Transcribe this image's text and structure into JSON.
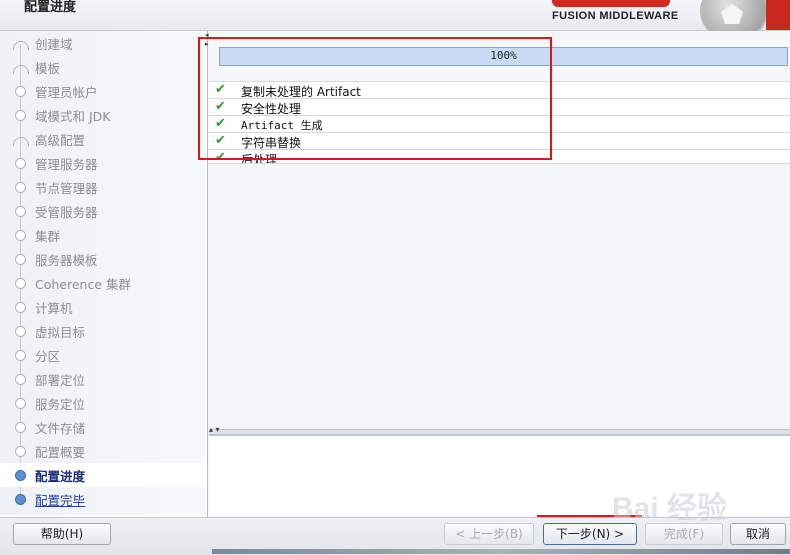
{
  "header": {
    "title": "配置进度",
    "brand_tagline": "FUSION MIDDLEWARE"
  },
  "nav": {
    "items": [
      {
        "label": "创建域",
        "state": "done"
      },
      {
        "label": "模板",
        "state": "done"
      },
      {
        "label": "管理员帐户",
        "state": "done"
      },
      {
        "label": "域模式和 JDK",
        "state": "done"
      },
      {
        "label": "高级配置",
        "state": "done"
      },
      {
        "label": "管理服务器",
        "state": "done"
      },
      {
        "label": "节点管理器",
        "state": "done"
      },
      {
        "label": "受管服务器",
        "state": "done"
      },
      {
        "label": "集群",
        "state": "done"
      },
      {
        "label": "服务器模板",
        "state": "done"
      },
      {
        "label": "Coherence 集群",
        "state": "done"
      },
      {
        "label": "计算机",
        "state": "done"
      },
      {
        "label": "虚拟目标",
        "state": "done"
      },
      {
        "label": "分区",
        "state": "done"
      },
      {
        "label": "部署定位",
        "state": "done"
      },
      {
        "label": "服务定位",
        "state": "done"
      },
      {
        "label": "文件存储",
        "state": "done"
      },
      {
        "label": "配置概要",
        "state": "done"
      },
      {
        "label": "配置进度",
        "state": "current"
      },
      {
        "label": "配置完毕",
        "state": "link"
      }
    ]
  },
  "progress": {
    "value": 1.0,
    "label": "100%"
  },
  "tasks": [
    {
      "label": "复制未处理的 Artifact",
      "status": "done"
    },
    {
      "label": "安全性处理",
      "status": "done"
    },
    {
      "label": "Artifact 生成",
      "status": "done"
    },
    {
      "label": "字符串替换",
      "status": "done"
    },
    {
      "label": "后处理",
      "status": "done"
    }
  ],
  "buttons": {
    "help": "帮助(H)",
    "back": "< 上一步(B)",
    "next": "下一步(N) >",
    "finish": "完成(F)",
    "cancel": "取消"
  },
  "watermark": "Bai 经验",
  "colors": {
    "accent_red": "#e0141a",
    "check_green": "#2d9a2d",
    "nav_current": "#1a2d7a"
  }
}
